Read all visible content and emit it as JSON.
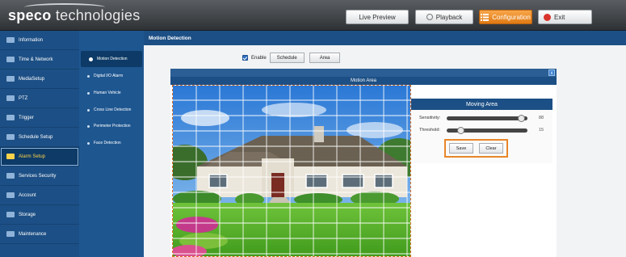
{
  "brand": {
    "name_bold": "speco",
    "name_light": " technologies"
  },
  "topnav": {
    "live_preview": "Live Preview",
    "playback": "Playback",
    "configuration": "Configuration",
    "exit": "Exit"
  },
  "sidebar": {
    "items": [
      {
        "label": "Information",
        "icon": "info-icon"
      },
      {
        "label": "Time & Network",
        "icon": "network-icon"
      },
      {
        "label": "MediaSetup",
        "icon": "media-icon"
      },
      {
        "label": "PTZ",
        "icon": "ptz-icon"
      },
      {
        "label": "Trigger",
        "icon": "trigger-icon"
      },
      {
        "label": "Schedule Setup",
        "icon": "schedule-icon"
      },
      {
        "label": "Alarm Setup",
        "icon": "alarm-icon"
      },
      {
        "label": "Services Security",
        "icon": "security-icon"
      },
      {
        "label": "Account",
        "icon": "account-icon"
      },
      {
        "label": "Storage",
        "icon": "storage-icon"
      },
      {
        "label": "Maintenance",
        "icon": "maintenance-icon"
      }
    ]
  },
  "subnav": {
    "items": [
      {
        "label": "Motion Detection"
      },
      {
        "label": "Digital I/O Alarm"
      },
      {
        "label": "Human Vehicle"
      },
      {
        "label": "Cross Line Detection"
      },
      {
        "label": "Perimeter Protection"
      },
      {
        "label": "Face Detection"
      }
    ]
  },
  "main": {
    "title": "Motion Detection",
    "enable_label": "Enable",
    "enable_checked": true,
    "schedule_button": "Schedule",
    "area_button": "Area"
  },
  "area": {
    "title": "Motion Area",
    "close": "x",
    "panel_title": "Moving Area",
    "sensitivity_label": "Sensitivity:",
    "sensitivity_value": "88",
    "threshold_label": "Threshold:",
    "threshold_value": "15",
    "save_button": "Save",
    "clear_button": "Clear"
  },
  "colors": {
    "accent": "#1c4f85",
    "highlight": "#e8862b"
  }
}
